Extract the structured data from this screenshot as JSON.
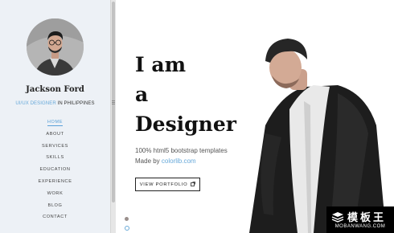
{
  "sidebar": {
    "name": "Jackson Ford",
    "role_prefix": "UI/UX DESIGNER",
    "role_suffix": " IN PHILIPPINES",
    "nav": [
      "HOME",
      "ABOUT",
      "SERVICES",
      "SKILLS",
      "EDUCATION",
      "EXPERIENCE",
      "WORK",
      "BLOG",
      "CONTACT"
    ],
    "active_nav": "HOME"
  },
  "hero": {
    "title_lines": [
      "I am",
      "a",
      "Designer"
    ],
    "subtitle": "100% html5 bootstrap templates",
    "made_by_prefix": "Made by ",
    "made_by_link": "colorlib.com",
    "button_label": "VIEW PORTFOLIO",
    "button_icon": "external-link-icon"
  },
  "slider": {
    "slides": 2,
    "active_index": 0
  },
  "watermark": {
    "title": "模板王",
    "url": "MOBANWANG.COM"
  },
  "colors": {
    "accent": "#66a8d9",
    "sidebar_bg": "#edf1f6",
    "text": "#111111"
  }
}
